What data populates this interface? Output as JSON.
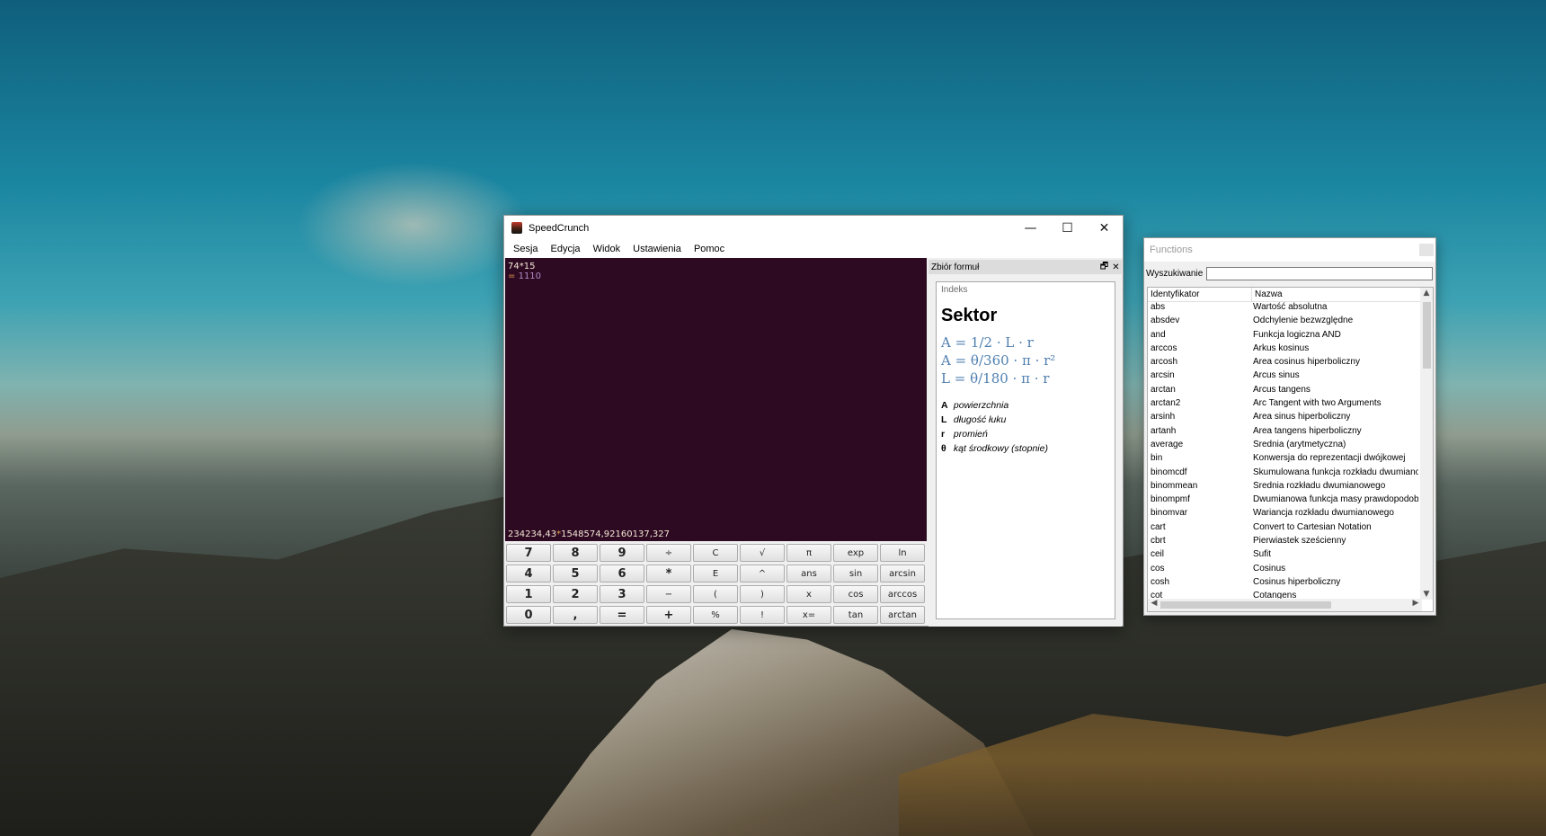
{
  "window": {
    "title": "SpeedCrunch",
    "minimize": "—",
    "maximize": "☐",
    "close": "✕"
  },
  "menu": [
    "Sesja",
    "Edycja",
    "Widok",
    "Ustawienia",
    "Pomoc"
  ],
  "display": {
    "expression": "74*15",
    "result_eq": "=",
    "result_value": "1110"
  },
  "input": {
    "left": "234234,43",
    "operator": "*",
    "right": "1548574,92160137,327"
  },
  "keypad": [
    [
      "7",
      "8",
      "9",
      "÷",
      "C",
      "√",
      "π",
      "exp",
      "ln"
    ],
    [
      "4",
      "5",
      "6",
      "*",
      "E",
      "^",
      "ans",
      "sin",
      "arcsin"
    ],
    [
      "1",
      "2",
      "3",
      "−",
      "(",
      ")",
      "x",
      "cos",
      "arccos"
    ],
    [
      "0",
      ",",
      "=",
      "+",
      "%",
      "!",
      "x=",
      "tan",
      "arctan"
    ]
  ],
  "formula_dock": {
    "title": "Zbiór formuł",
    "float_icon": "🗗",
    "close_icon": "✕",
    "index_link": "Indeks",
    "formula_title": "Sektor",
    "equations": [
      "A = 1/2 · L · r",
      "A = θ/360 · π · r²",
      "L = θ/180 · π · r"
    ],
    "variables": [
      {
        "symbol": "A",
        "desc": "powierzchnia"
      },
      {
        "symbol": "L",
        "desc": "długość łuku"
      },
      {
        "symbol": "r",
        "desc": "promień"
      },
      {
        "symbol": "θ",
        "desc": "kąt środkowy (stopnie)"
      }
    ]
  },
  "functions_window": {
    "title": "Functions",
    "search_label": "Wyszukiwanie",
    "search_value": "",
    "col_id": "Identyfikator",
    "col_name": "Nazwa",
    "rows": [
      [
        "abs",
        "Wartość absolutna"
      ],
      [
        "absdev",
        "Odchylenie bezwzględne"
      ],
      [
        "and",
        "Funkcja logiczna AND"
      ],
      [
        "arccos",
        "Arkus kosinus"
      ],
      [
        "arcosh",
        "Area cosinus hiperboliczny"
      ],
      [
        "arcsin",
        "Arcus sinus"
      ],
      [
        "arctan",
        "Arcus tangens"
      ],
      [
        "arctan2",
        "Arc Tangent with two Arguments"
      ],
      [
        "arsinh",
        "Area sinus hiperboliczny"
      ],
      [
        "artanh",
        "Area tangens hiperboliczny"
      ],
      [
        "average",
        "Średnia (arytmetyczna)"
      ],
      [
        "bin",
        "Konwersja do reprezentacji dwójkowej"
      ],
      [
        "binomcdf",
        "Skumulowana funkcja rozkładu dwumianowego"
      ],
      [
        "binommean",
        "Średnia rozkładu dwumianowego"
      ],
      [
        "binompmf",
        "Dwumianowa funkcja masy prawdopodobieństwa"
      ],
      [
        "binomvar",
        "Wariancja rozkładu dwumianowego"
      ],
      [
        "cart",
        "Convert to Cartesian Notation"
      ],
      [
        "cbrt",
        "Pierwiastek sześcienny"
      ],
      [
        "ceil",
        "Sufit"
      ],
      [
        "cos",
        "Cosinus"
      ],
      [
        "cosh",
        "Cosinus hiperboliczny"
      ],
      [
        "cot",
        "Cotangens"
      ]
    ]
  }
}
